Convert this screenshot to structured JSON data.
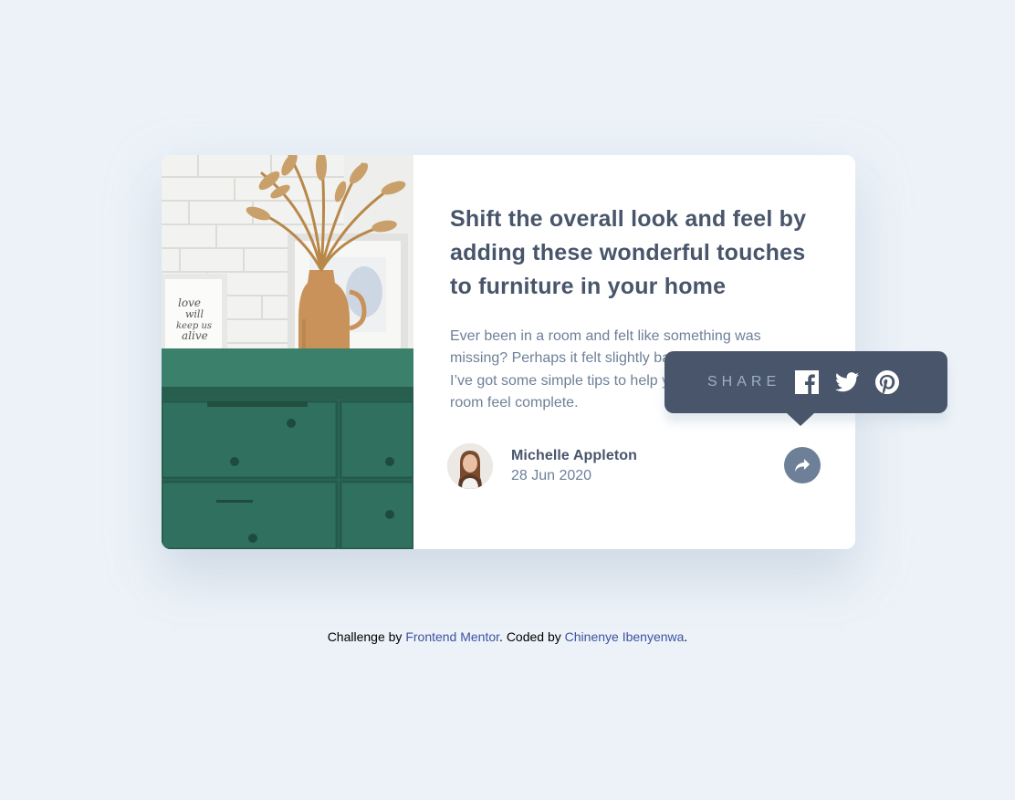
{
  "article": {
    "headline": "Shift the overall look and feel by adding these wonderful touches to furniture in your home",
    "excerpt": "Ever been in a room and felt like something was missing? Perhaps it felt slightly bare and uninviting. I’ve got some simple tips to help you make any room feel complete.",
    "image_icon": "drawers-photo"
  },
  "author": {
    "name": "Michelle Appleton",
    "date": "28 Jun 2020",
    "avatar_icon": "avatar-photo"
  },
  "share": {
    "label": "SHARE",
    "button_icon": "share-icon",
    "networks": [
      {
        "name": "facebook",
        "icon": "facebook-icon"
      },
      {
        "name": "twitter",
        "icon": "twitter-icon"
      },
      {
        "name": "pinterest",
        "icon": "pinterest-icon"
      }
    ]
  },
  "attribution": {
    "prefix": "Challenge by ",
    "link1": "Frontend Mentor",
    "middle": ". Coded by ",
    "link2": "Chinenye Ibenyenwa",
    "suffix": "."
  },
  "colors": {
    "background": "#ecf2f8",
    "card": "#ffffff",
    "heading": "#48556a",
    "body_text": "#6e8098",
    "popover_bg": "#48556a",
    "share_label": "#9eafc2",
    "link": "#3e52a3"
  }
}
